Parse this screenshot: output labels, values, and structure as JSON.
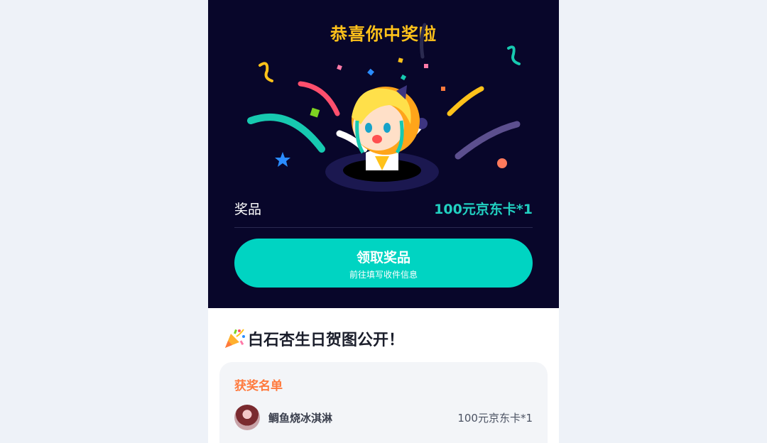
{
  "prize_card": {
    "headline": "恭喜你中奖啦",
    "prize_label": "奖品",
    "prize_value": "100元京东卡*1",
    "claim_button": {
      "label": "领取奖品",
      "sublabel": "前往填写收件信息"
    }
  },
  "announcement": {
    "icon": "party-popper-icon",
    "title": "白石杏生日贺图公开！"
  },
  "winners": {
    "heading": "获奖名单",
    "list": [
      {
        "name": "鲷鱼烧冰淇淋",
        "prize": "100元京东卡*1"
      }
    ]
  },
  "colors": {
    "card_bg": "#08062a",
    "headline": "#ffc21a",
    "accent": "#00d4c2",
    "winners_heading": "#ff7a3d"
  }
}
